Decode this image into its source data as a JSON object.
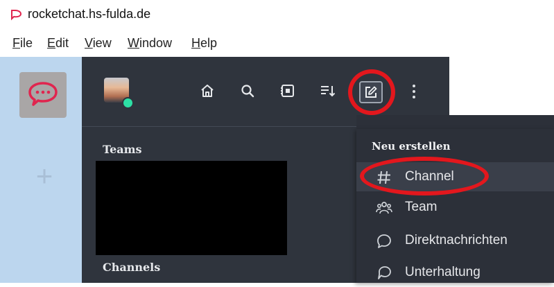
{
  "window": {
    "title": "rocketchat.hs-fulda.de"
  },
  "menubar": {
    "items": [
      {
        "underline": "F",
        "rest": "ile"
      },
      {
        "underline": "E",
        "rest": "dit"
      },
      {
        "underline": "V",
        "rest": "iew"
      },
      {
        "underline": "W",
        "rest": "indow"
      },
      {
        "underline": "H",
        "rest": "elp"
      }
    ]
  },
  "rail": {
    "add_symbol": "+"
  },
  "sidebar": {
    "sections": {
      "teams": "Teams",
      "channels": "Channels"
    }
  },
  "create_menu": {
    "title": "Neu erstellen",
    "items": [
      {
        "label": "Channel",
        "icon": "hash-icon"
      },
      {
        "label": "Team",
        "icon": "team-icon"
      },
      {
        "label": "Direktnachrichten",
        "icon": "direct-message-icon"
      },
      {
        "label": "Unterhaltung",
        "icon": "discussion-icon"
      }
    ]
  },
  "colors": {
    "sidebar_bg": "#2f343d",
    "menu_bg": "#2c3039",
    "rail_bg": "#bcd6ee",
    "annotation": "#e3171d",
    "status_online": "#2de0a5"
  }
}
